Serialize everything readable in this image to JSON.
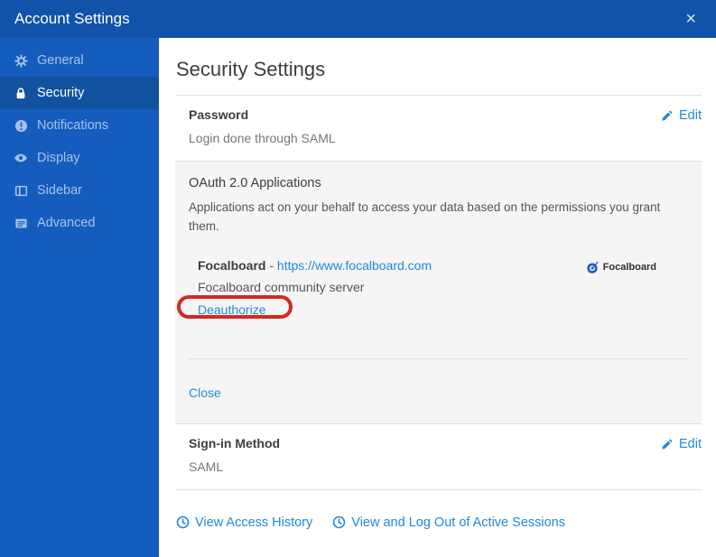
{
  "colors": {
    "header_bg": "#1153ab",
    "sidebar_bg": "#145dbf",
    "sidebar_active_bg": "#11529f",
    "link": "#2389d7",
    "annotation": "#d6281f"
  },
  "header": {
    "title": "Account Settings",
    "close_icon": "×"
  },
  "sidebar": {
    "items": [
      {
        "label": "General",
        "icon": "gear-icon",
        "active": false
      },
      {
        "label": "Security",
        "icon": "lock-icon",
        "active": true
      },
      {
        "label": "Notifications",
        "icon": "exclamation-circle-icon",
        "active": false
      },
      {
        "label": "Display",
        "icon": "eye-icon",
        "active": false
      },
      {
        "label": "Sidebar",
        "icon": "columns-icon",
        "active": false
      },
      {
        "label": "Advanced",
        "icon": "list-icon",
        "active": false
      }
    ]
  },
  "content": {
    "title": "Security Settings",
    "password": {
      "title": "Password",
      "description": "Login done through SAML",
      "edit_label": "Edit"
    },
    "oauth": {
      "title": "OAuth 2.0 Applications",
      "description": "Applications act on your behalf to access your data based on the permissions you grant them.",
      "app": {
        "name": "Focalboard",
        "separator": "-",
        "url": "https://www.focalboard.com",
        "description": "Focalboard community server",
        "deauthorize_label": "Deauthorize",
        "logo_label": "Focalboard"
      },
      "close_label": "Close"
    },
    "signin": {
      "title": "Sign-in Method",
      "value": "SAML",
      "edit_label": "Edit"
    },
    "footer_links": [
      {
        "label": "View Access History"
      },
      {
        "label": "View and Log Out of Active Sessions"
      }
    ]
  }
}
